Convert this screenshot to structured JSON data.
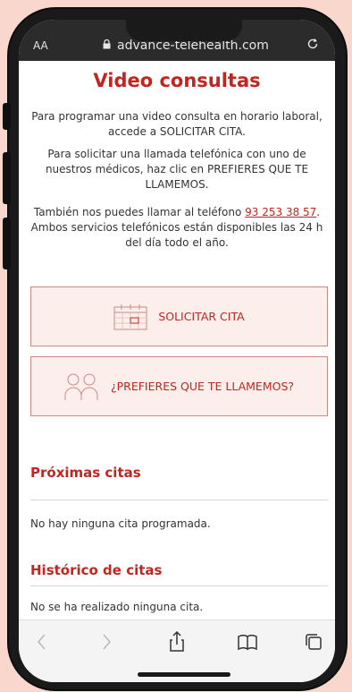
{
  "browser": {
    "aa_label": "AA",
    "url": "advance-telehealth.com"
  },
  "page": {
    "title": "Video consultas",
    "para1": "Para programar una video consulta en horario laboral, accede a SOLICITAR CITA.",
    "para2": "Para solicitar una llamada telefónica con uno de nuestros médicos, haz clic en PREFIERES QUE TE LLAMEMOS.",
    "para3_prefix": "También nos puedes llamar al teléfono ",
    "phone": "93 253 38 57",
    "para3_suffix": ". Ambos servicios telefónicos están disponibles las 24 h del día todo el año.",
    "solicitar_label": "SOLICITAR CITA",
    "llamemos_label": "¿PREFIERES QUE TE LLAMEMOS?",
    "proximas_title": "Próximas citas",
    "proximas_empty": "No hay ninguna cita programada.",
    "historico_title": "Histórico de citas",
    "historico_empty": "No se ha realizado ninguna cita."
  },
  "icons": {
    "lock": "lock-icon",
    "reload": "reload-icon",
    "calendar": "calendar-icon",
    "people": "people-icon",
    "back": "back-icon",
    "forward": "forward-icon",
    "share": "share-icon",
    "bookmarks": "book-icon",
    "tabs": "tabs-icon"
  },
  "colors": {
    "brand_red": "#c0261f",
    "button_bg": "#fbeeeb",
    "frame_bg": "#f9d7cc"
  }
}
